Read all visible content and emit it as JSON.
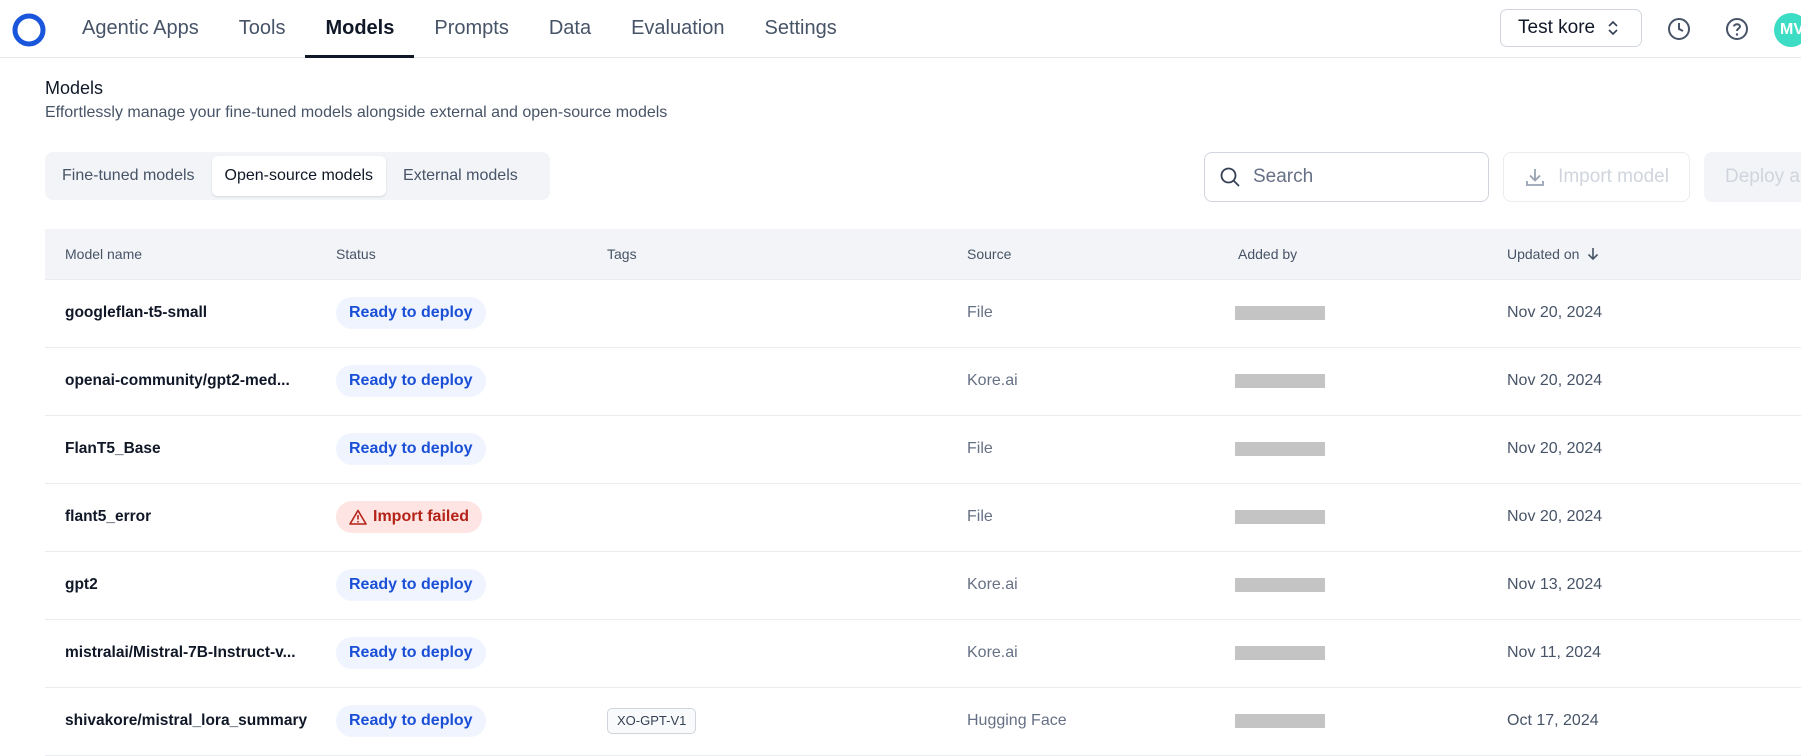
{
  "nav": {
    "items": [
      {
        "label": "Agentic Apps",
        "active": false
      },
      {
        "label": "Tools",
        "active": false
      },
      {
        "label": "Models",
        "active": true
      },
      {
        "label": "Prompts",
        "active": false
      },
      {
        "label": "Data",
        "active": false
      },
      {
        "label": "Evaluation",
        "active": false
      },
      {
        "label": "Settings",
        "active": false
      }
    ],
    "workspace": "Test kore",
    "avatar_initials": "MV"
  },
  "header": {
    "title": "Models",
    "subtitle": "Effortlessly manage your fine-tuned models alongside external and open-source models"
  },
  "tabs": [
    {
      "label": "Fine-tuned models",
      "active": false
    },
    {
      "label": "Open-source models",
      "active": true
    },
    {
      "label": "External models",
      "active": false
    }
  ],
  "search": {
    "placeholder": "Search",
    "value": ""
  },
  "actions": {
    "import_label": "Import model",
    "deploy_label": "Deploy a model"
  },
  "table": {
    "columns": [
      "Model name",
      "Status",
      "Tags",
      "Source",
      "Added by",
      "Updated on"
    ],
    "rows": [
      {
        "name": "googleflan-t5-small",
        "status": "Ready to deploy",
        "status_type": "ready",
        "tag": "",
        "source": "File",
        "updated": "Nov 20, 2024"
      },
      {
        "name": "openai-community/gpt2-med...",
        "status": "Ready to deploy",
        "status_type": "ready",
        "tag": "",
        "source": "Kore.ai",
        "updated": "Nov 20, 2024"
      },
      {
        "name": "FlanT5_Base",
        "status": "Ready to deploy",
        "status_type": "ready",
        "tag": "",
        "source": "File",
        "updated": "Nov 20, 2024"
      },
      {
        "name": "flant5_error",
        "status": "Import failed",
        "status_type": "failed",
        "tag": "",
        "source": "File",
        "updated": "Nov 20, 2024"
      },
      {
        "name": "gpt2",
        "status": "Ready to deploy",
        "status_type": "ready",
        "tag": "",
        "source": "Kore.ai",
        "updated": "Nov 13, 2024"
      },
      {
        "name": "mistralai/Mistral-7B-Instruct-v...",
        "status": "Ready to deploy",
        "status_type": "ready",
        "tag": "",
        "source": "Kore.ai",
        "updated": "Nov 11, 2024"
      },
      {
        "name": "shivakore/mistral_lora_summary",
        "status": "Ready to deploy",
        "status_type": "ready",
        "tag": "XO-GPT-V1",
        "source": "Hugging Face",
        "updated": "Oct 17, 2024"
      }
    ]
  },
  "colors": {
    "accent": "#101828",
    "ready_text": "#1a4fd6",
    "failed_text": "#b42318",
    "avatar_bg": "#3ddcc4"
  },
  "icons": [
    "logo-icon",
    "chevron-updown-icon",
    "clock-icon",
    "help-icon",
    "search-icon",
    "download-icon",
    "arrow-down-icon",
    "warning-icon"
  ]
}
